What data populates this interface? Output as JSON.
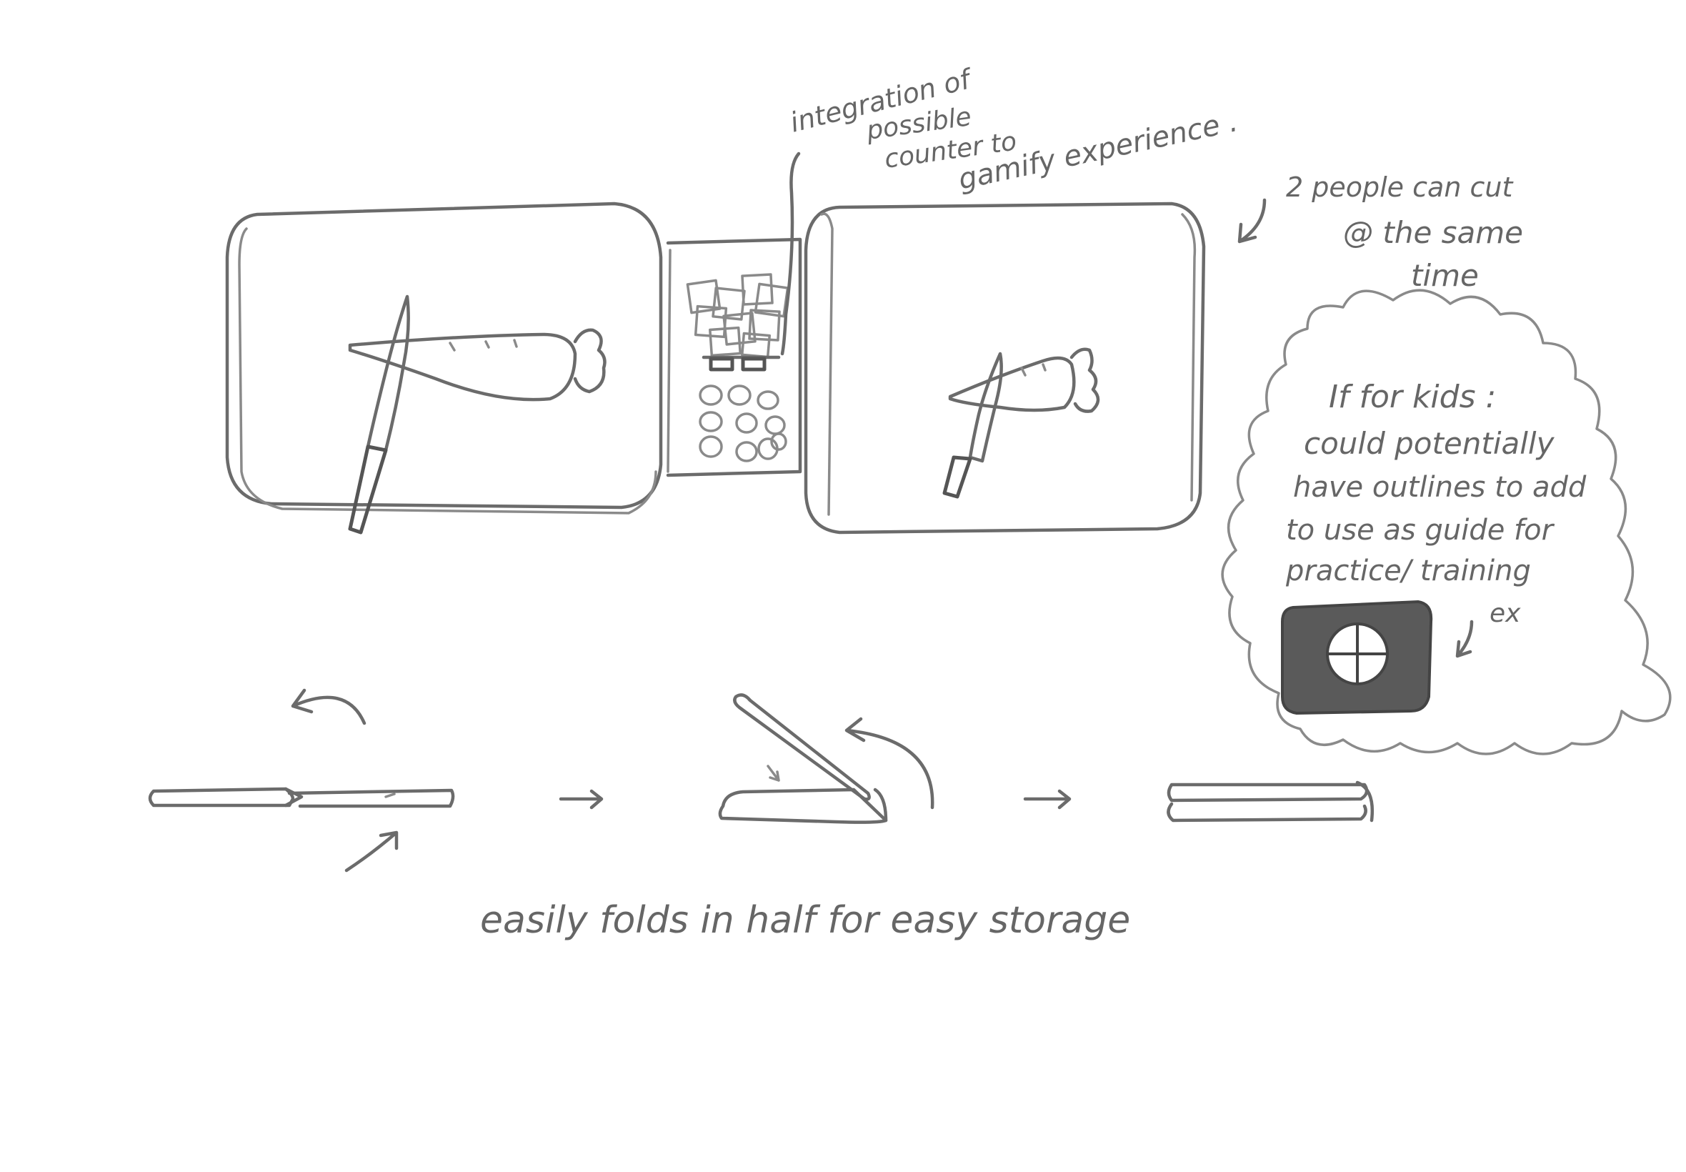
{
  "annotations": {
    "gamify": {
      "line1": "integration of",
      "line2": "possible",
      "line3": "counter to",
      "line4": "gamify experience ."
    },
    "two_people": {
      "line1": "2 people can cut",
      "line2": "@ the same",
      "line3": "time"
    },
    "kids": {
      "line1": "If for kids :",
      "line2": "could potentially",
      "line3": "have outlines to add",
      "line4": "to use as guide for",
      "line5": "practice/ training",
      "example": "ex"
    },
    "folding": {
      "caption": "easily folds in half for easy storage"
    }
  },
  "colors": {
    "stroke": "#6b6b6b",
    "light_stroke": "#8a8a8a",
    "dark_fill": "#555555",
    "text": "#666666"
  }
}
